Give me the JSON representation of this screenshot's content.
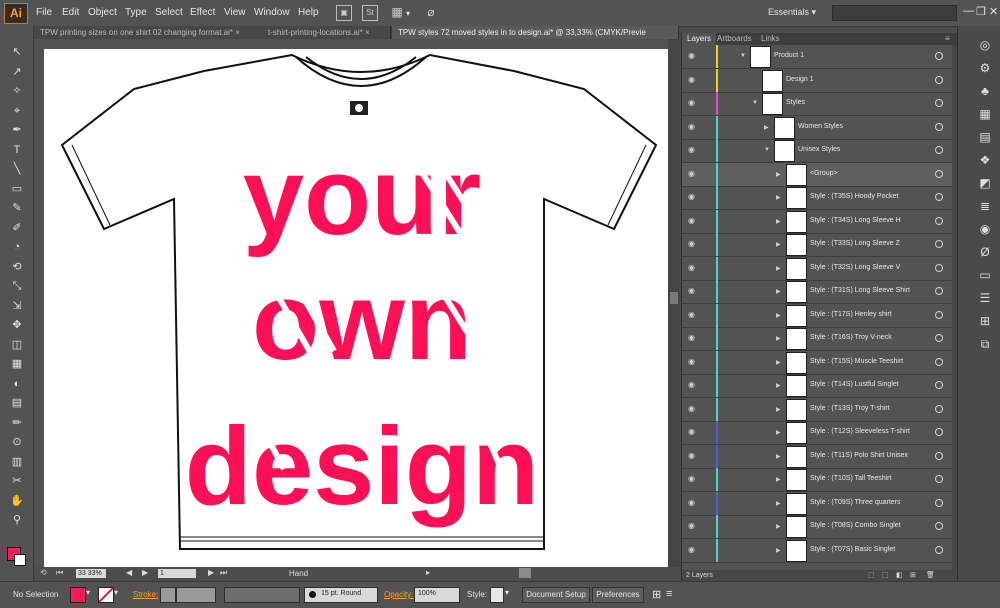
{
  "app": {
    "logo": "Ai"
  },
  "menu": [
    "File",
    "Edit",
    "Object",
    "Type",
    "Select",
    "Effect",
    "View",
    "Window",
    "Help"
  ],
  "menubar": {
    "workspace": "Essentials",
    "workspace_arrow": "▾",
    "bridge_icon": "▣",
    "st_label": "St",
    "arrange_icon": "▦",
    "arrange_arrow": "▾",
    "gpu_icon": "⌀",
    "min": "—",
    "restore": "❐",
    "close": "✕"
  },
  "tabs": [
    {
      "label": "TPW printing sizes on one shirt 02 changing format.ai*",
      "close": "×"
    },
    {
      "label": "t-shirt-printing-locations.ai*",
      "close": "×"
    },
    {
      "label": "TPW styles 72 moved styles in to design.ai* @ 33,33% (CMYK/Previe",
      "close": "×"
    }
  ],
  "artwork": {
    "line1": "your",
    "line2": "own",
    "line3": "design",
    "tag_color": "#ff0f55"
  },
  "status": {
    "zoom": "33 33%",
    "page": "1",
    "tool": "Hand",
    "expand": "▸",
    "prev": "◀",
    "next": "▶",
    "rotate": "⟲",
    "first": "⏮",
    "last": "⏭"
  },
  "panel": {
    "tabs": [
      "Layers",
      "Artboards",
      "Links"
    ],
    "menu_icon": "≡",
    "footer": "2 Layers",
    "footer_icons": [
      "⬚",
      "⬚",
      "◧",
      "⊞",
      "⊟",
      "🗑"
    ],
    "eye": "◉",
    "expanded": "▼",
    "collapsed": "▶",
    "rows": [
      {
        "label": "Product 1",
        "indent": 0,
        "arrow": "expanded",
        "color": "#f2d21b"
      },
      {
        "label": "Design 1",
        "indent": 1,
        "arrow": "",
        "color": "#f2d21b"
      },
      {
        "label": "Styles",
        "indent": 1,
        "arrow": "expanded",
        "color": "#e04ad3"
      },
      {
        "label": "Women Styles",
        "indent": 2,
        "arrow": "collapsed",
        "color": "#4ad3d3"
      },
      {
        "label": "Unisex Styles",
        "indent": 2,
        "arrow": "expanded",
        "color": "#4ad3d3"
      },
      {
        "label": "<Group>",
        "indent": 3,
        "arrow": "collapsed",
        "color": "#4ad3d3"
      },
      {
        "label": "Style : (T35S) Hoody Pocket",
        "indent": 3,
        "arrow": "collapsed",
        "color": "#4ad3d3"
      },
      {
        "label": "Style : (T34S) Long Sleeve H",
        "indent": 3,
        "arrow": "collapsed",
        "color": "#4ad3d3"
      },
      {
        "label": "Style : (T33S) Long Sleeve Z",
        "indent": 3,
        "arrow": "collapsed",
        "color": "#4ad3d3"
      },
      {
        "label": "Style : (T32S) Long Sleeve V",
        "indent": 3,
        "arrow": "collapsed",
        "color": "#4ad3d3"
      },
      {
        "label": "Style : (T31S) Long Sleeve Shirt",
        "indent": 3,
        "arrow": "collapsed",
        "color": "#4ad3d3"
      },
      {
        "label": "Style : (T17S) Henley shirt",
        "indent": 3,
        "arrow": "collapsed",
        "color": "#4ad3d3"
      },
      {
        "label": "Style : (T16S) Troy V-neck",
        "indent": 3,
        "arrow": "collapsed",
        "color": "#4ad3d3"
      },
      {
        "label": "Style : (T15S) Muscle Teeshirt",
        "indent": 3,
        "arrow": "collapsed",
        "color": "#4ad3d3"
      },
      {
        "label": "Style : (T14S) Lustful Singlet",
        "indent": 3,
        "arrow": "collapsed",
        "color": "#4ad3d3"
      },
      {
        "label": "Style : (T13S) Troy T-shirt",
        "indent": 3,
        "arrow": "collapsed",
        "color": "#4ad3d3"
      },
      {
        "label": "Style : (T12S) Sleeveless T-shirt",
        "indent": 3,
        "arrow": "collapsed",
        "color": "#5a5ad8"
      },
      {
        "label": "Style : (T11S) Polo Shirt Unisex",
        "indent": 3,
        "arrow": "collapsed",
        "color": "#5a5ad8"
      },
      {
        "label": "Style : (T10S) Tall Teeshirt",
        "indent": 3,
        "arrow": "collapsed",
        "color": "#4ad3d3"
      },
      {
        "label": "Style : (T09S) Three quarters",
        "indent": 3,
        "arrow": "collapsed",
        "color": "#5a5ad8"
      },
      {
        "label": "Style : (T08S) Combo Singlet",
        "indent": 3,
        "arrow": "collapsed",
        "color": "#4ad3d3"
      },
      {
        "label": "Style : (T07S) Basic Singlet",
        "indent": 3,
        "arrow": "collapsed",
        "color": "#4ad3d3"
      }
    ]
  },
  "control": {
    "selection": "No Selection",
    "fill_color": "#ff1a55",
    "stroke_label": "Stroke:",
    "brush": "15 pt. Round",
    "opacity_label": "Opacity:",
    "opacity": "100%",
    "style_label": "Style:",
    "doc_setup": "Document Setup",
    "preferences": "Preferences",
    "dropdown": "▾",
    "arrange_icon": "⊞",
    "menu_icon": "≡"
  },
  "tools": [
    "↖",
    "↗",
    "✧",
    "⌖",
    "✒",
    "T",
    "╲",
    "▭",
    "✎",
    "✐",
    "◔",
    "⟲",
    "⤡",
    "⇲",
    "✥",
    "◫",
    "▦",
    "◐",
    "▤",
    "✏",
    "⊙",
    "▥",
    "✂",
    "✋",
    "⚲"
  ],
  "dock_icons": [
    "◎",
    "⚙",
    "♣",
    "▦",
    "▤",
    "❖",
    "◩",
    "≣",
    "◉",
    "Ø",
    "▭",
    "☰",
    "⊞",
    "⧉"
  ]
}
